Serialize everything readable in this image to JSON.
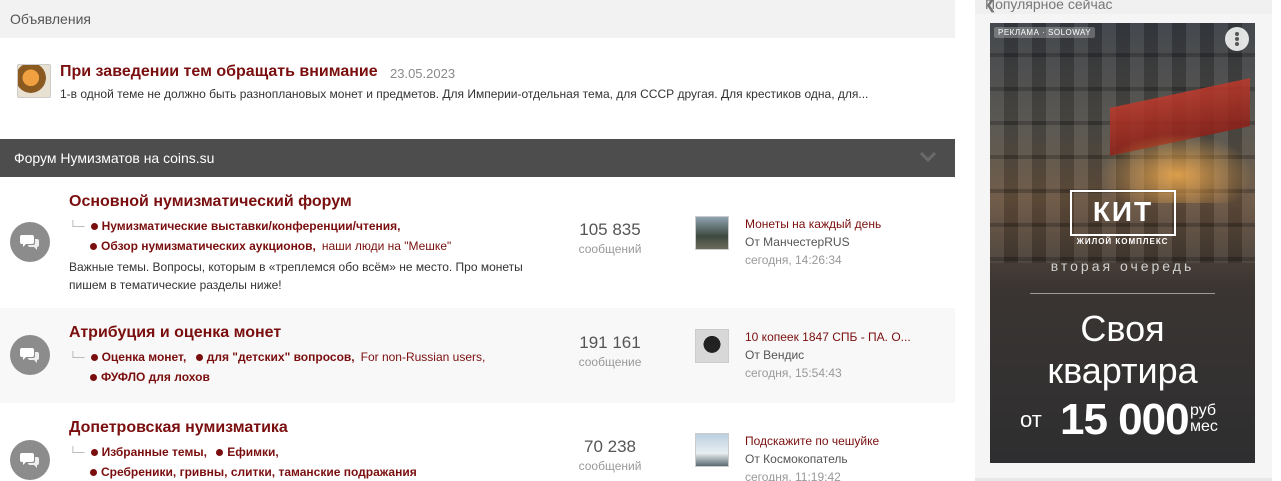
{
  "announcements": {
    "header": "Объявления",
    "title": "При заведении тем обращать внимание",
    "date": "23.05.2023",
    "text": "1-в одной теме не должно быть разноплановых монет и предметов. Для Империи-отдельная тема, для СССР другая. Для крестиков одна, для..."
  },
  "forum": {
    "category_title": "Форум Нумизматов на coins.su",
    "rows": [
      {
        "title": "Основной нумизматический форум",
        "sub1_bold": "Нумизматические выставки/конференции/чтения,",
        "sub2_bold": "Обзор нумизматических аукционов,",
        "sub2_reg": "наши люди на \"Мешке\"",
        "desc": "Важные темы. Вопросы, которым в «треплемся обо всём» не место. Про монеты пишем в тематические разделы ниже!",
        "count": "105 835",
        "count_label": "сообщений",
        "last_title": "Монеты на каждый день",
        "last_by": "От МанчестерRUS",
        "last_time": "сегодня, 14:26:34"
      },
      {
        "title": "Атрибуция и оценка монет",
        "sub1_a": "Оценка монет,",
        "sub1_b": "для \"детских\" вопросов,",
        "sub1_reg": "For non-Russian users,",
        "sub2_bold": "ФУФЛО для лохов",
        "count": "191 161",
        "count_label": "сообщение",
        "last_title": "10 копеек 1847 СПБ - ПА. О...",
        "last_by": "От Вендис",
        "last_time": "сегодня, 15:54:43"
      },
      {
        "title": "Допетровская нумизматика",
        "sub1_a": "Избранные темы,",
        "sub1_b": "Ефимки,",
        "sub2_bold": "Сребреники, гривны, слитки, таманские подражания",
        "count": "70 238",
        "count_label": "сообщений",
        "last_title": "Подскажите по чешуйке",
        "last_by": "От Космокопатель",
        "last_time": "сегодня, 11:19:42"
      }
    ]
  },
  "sidebar": {
    "header": "Популярное сейчас",
    "ad": {
      "label": "РЕКЛАМА · SOLOWAY",
      "brand": "КИТ",
      "brand_sub": "ЖИЛОЙ КОМПЛЕКС",
      "queue": "вторая очередь",
      "headline1": "Своя",
      "headline2": "квартира",
      "price_from": "от",
      "price_amount": "15 000",
      "price_unit1": "руб",
      "price_unit2": "мес"
    }
  },
  "colors": {
    "link": "#7a0e0e",
    "bar": "#4d4d4d",
    "icon_circle": "#8c8c8c"
  }
}
